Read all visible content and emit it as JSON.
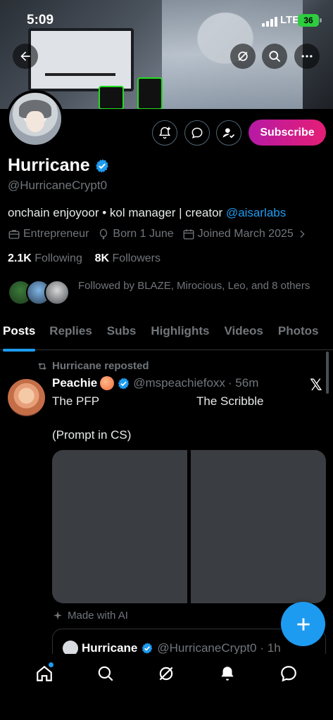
{
  "status": {
    "time": "5:09",
    "network": "LTE",
    "battery": "36"
  },
  "profile": {
    "name": "Hurricane",
    "handle": "@HurricaneCrypt0",
    "bio_text": "onchain enjoyoor • kol manager | creator ",
    "bio_link": "@aisarlabs",
    "category": "Entrepreneur",
    "born": "Born 1 June",
    "joined": "Joined March 2025",
    "following_count": "2.1K",
    "following_label": "Following",
    "followers_count": "8K",
    "followers_label": "Followers",
    "followed_by": "Followed by BLAZE, Mirocious, Leo, and 8 others",
    "subscribe_label": "Subscribe"
  },
  "tabs": [
    "Posts",
    "Replies",
    "Subs",
    "Highlights",
    "Videos",
    "Photos"
  ],
  "post": {
    "repost_label": "Hurricane reposted",
    "author_name": "Peachie",
    "author_handle": "@mspeachiefoxx",
    "time": "· 56m",
    "text_left": "The PFP",
    "text_right": "The Scribble",
    "text_line2": "(Prompt in CS)",
    "made_with_ai": "Made with AI",
    "quote_name": "Hurricane",
    "quote_handle": "@HurricaneCrypt0",
    "quote_time": "· 1h"
  },
  "colors": {
    "accent": "#1d9bf0",
    "subscribe_start": "#b61aa5",
    "subscribe_end": "#e51e76"
  },
  "icons": {
    "back": "arrow-left-icon",
    "grok": "grok-icon",
    "search": "search-icon",
    "more": "more-icon",
    "notify": "bell-plus-icon",
    "message": "message-icon",
    "follow": "user-check-icon",
    "home": "home-icon",
    "notifications": "bell-icon",
    "chat": "chat-icon",
    "compose": "plus-icon"
  }
}
